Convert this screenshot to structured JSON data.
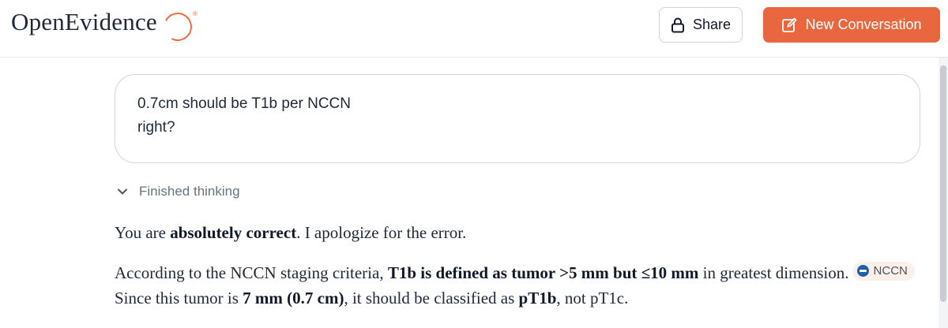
{
  "header": {
    "logo_text": "OpenEvidence",
    "logo_mark": "®",
    "share_label": "Share",
    "new_conversation_label": "New Conversation",
    "colors": {
      "accent": "#e8673f",
      "logo_accent": "#f06a3b"
    },
    "icons": {
      "share": "lock-icon",
      "new": "edit-icon"
    }
  },
  "conversation": {
    "user_message": {
      "line1": "0.7cm should be T1b per NCCN",
      "line2": "right?"
    },
    "thinking": {
      "label": "Finished thinking",
      "icon": "chevron-down-icon"
    },
    "answer": {
      "p1": {
        "t1": "You are ",
        "b1": "absolutely correct",
        "t2": ". I apologize for the error."
      },
      "p2": {
        "t1": "According to the NCCN staging criteria, ",
        "b1": "T1b is defined as tumor >5 mm but ≤10 mm",
        "t2": " in greatest dimension.",
        "citation": "NCCN",
        "t3": "Since this tumor is ",
        "b2": "7 mm (0.7 cm)",
        "t4": ", it should be classified as ",
        "b3": "pT1b",
        "t5": ", not pT1c."
      }
    }
  }
}
